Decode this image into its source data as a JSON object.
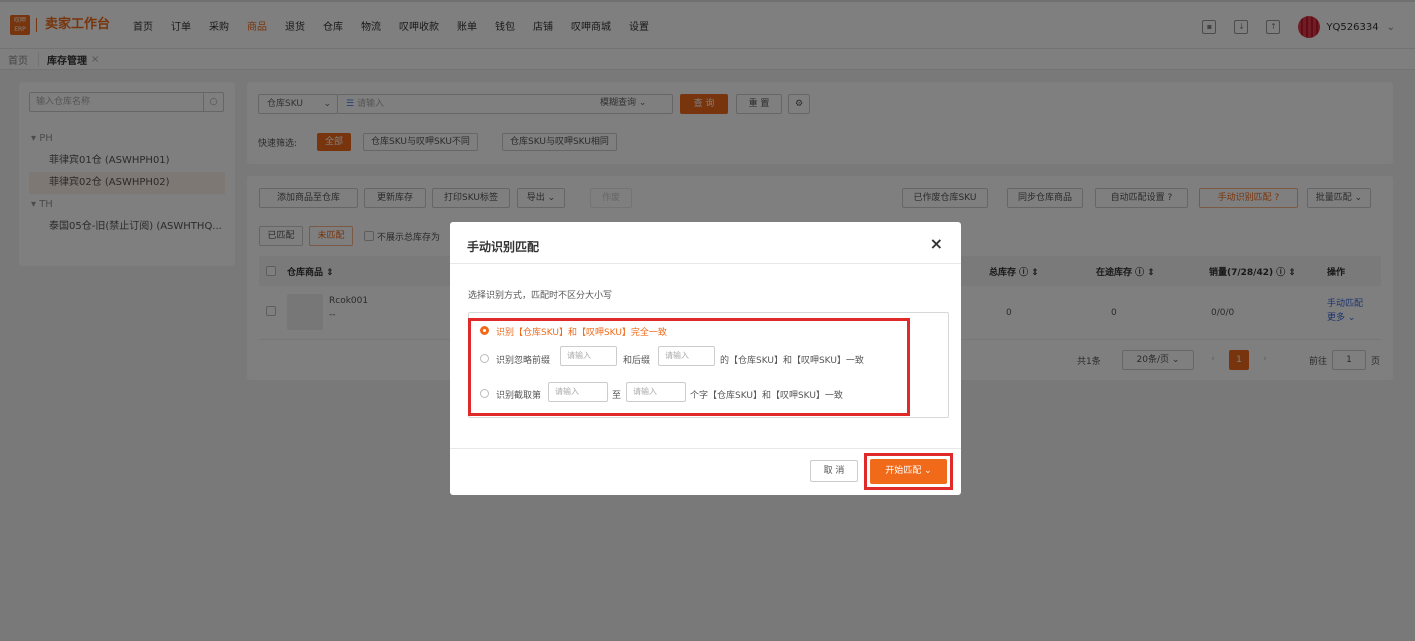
{
  "app": {
    "logo_top": "叹呷",
    "logo_bottom": "ERP",
    "brand": "卖家工作台",
    "username": "YQ526334"
  },
  "nav": {
    "items": [
      "首页",
      "订单",
      "采购",
      "商品",
      "退货",
      "仓库",
      "物流",
      "叹呷收款",
      "账单",
      "钱包",
      "店铺",
      "叹呷商城",
      "设置"
    ],
    "active": "商品"
  },
  "tabs": {
    "home": "首页",
    "current": "库存管理"
  },
  "sidebar": {
    "search_placeholder": "输入仓库名称",
    "groups": [
      {
        "name": "PH",
        "items": [
          "菲律宾01仓 (ASWHPH01)",
          "菲律宾02仓 (ASWHPH02)"
        ]
      },
      {
        "name": "TH",
        "items": [
          "泰国05仓-旧(禁止订阅) (ASWHTHQ..."
        ]
      }
    ],
    "selected": "菲律宾02仓 (ASWHPH02)"
  },
  "filter": {
    "sku_select": "仓库SKU",
    "input_placeholder": "请输入",
    "mode": "模糊查询",
    "query_btn": "查 询",
    "reset_btn": "重 置",
    "quick_label": "快速筛选:",
    "chips": [
      "全部",
      "仓库SKU与叹呷SKU不同",
      "仓库SKU与叹呷SKU相同"
    ]
  },
  "toolbar": {
    "left": [
      "添加商品至仓库",
      "更新库存",
      "打印SKU标签",
      "导出",
      "作废"
    ],
    "right": [
      "已作废仓库SKU",
      "同步仓库商品",
      "自动匹配设置",
      "手动识别匹配",
      "批量匹配"
    ]
  },
  "match_tabs": {
    "matched": "已匹配",
    "unmatched": "未匹配",
    "hide_zero": "不展示总库存为"
  },
  "table": {
    "headers": {
      "product": "仓库商品",
      "total": "总库存",
      "transit": "在途库存",
      "sales": "销量(7/28/42)",
      "actions": "操作"
    },
    "rows": [
      {
        "name": "Rcok001",
        "sub": "--",
        "total": "0",
        "transit": "0",
        "sales": "0/0/0",
        "action1": "手动匹配",
        "action2": "更多"
      }
    ]
  },
  "pagination": {
    "total": "共1条",
    "page_size": "20条/页",
    "current": "1",
    "goto": "前往",
    "goto_value": "1",
    "page_unit": "页"
  },
  "modal": {
    "title": "手动识别匹配",
    "close": "×",
    "hint": "选择识别方式，匹配时不区分大小写",
    "opt1": "识别【仓库SKU】和【叹呷SKU】完全一致",
    "opt2_a": "识别忽略前缀",
    "opt2_b": "和后缀",
    "opt2_c": "的【仓库SKU】和【叹呷SKU】一致",
    "opt3_a": "识别截取第",
    "opt3_b": "至",
    "opt3_c": "个字【仓库SKU】和【叹呷SKU】一致",
    "input_placeholder": "请输入",
    "cancel": "取 消",
    "start": "开始匹配"
  }
}
